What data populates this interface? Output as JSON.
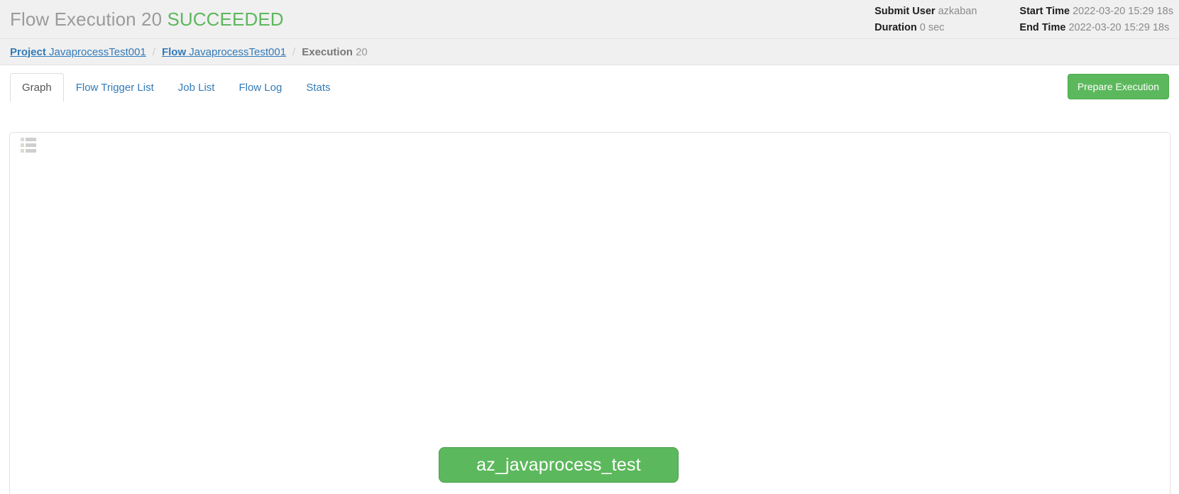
{
  "header": {
    "title_prefix": "Flow Execution 20",
    "status": "SUCCEEDED",
    "status_color": "#5cb85c",
    "meta": {
      "submit_user_label": "Submit User",
      "submit_user_value": "azkaban",
      "duration_label": "Duration",
      "duration_value": "0 sec",
      "start_time_label": "Start Time",
      "start_time_value": "2022-03-20 15:29 18s",
      "end_time_label": "End Time",
      "end_time_value": "2022-03-20 15:29 18s"
    }
  },
  "breadcrumb": {
    "separator": "/",
    "items": [
      {
        "key": "Project",
        "value": "JavaprocessTest001"
      },
      {
        "key": "Flow",
        "value": "JavaprocessTest001"
      },
      {
        "key": "Execution",
        "value": "20"
      }
    ]
  },
  "tabs": {
    "items": [
      {
        "label": "Graph",
        "active": true
      },
      {
        "label": "Flow Trigger List",
        "active": false
      },
      {
        "label": "Job List",
        "active": false
      },
      {
        "label": "Flow Log",
        "active": false
      },
      {
        "label": "Stats",
        "active": false
      }
    ],
    "prepare_button_label": "Prepare Execution"
  },
  "graph": {
    "list_toggle_icon": "th-list-icon",
    "nodes": [
      {
        "label": "az_javaprocess_test",
        "status": "SUCCEEDED",
        "color": "#5cb85c"
      }
    ]
  }
}
